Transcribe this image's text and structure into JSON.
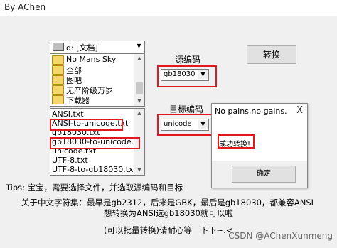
{
  "window": {
    "title": "By AChen"
  },
  "drive": {
    "label": "d: [文档]"
  },
  "folders": {
    "items": [
      "No Mans Sky",
      "全部",
      "图吧",
      "无产阶级万岁",
      "下载器"
    ]
  },
  "files": {
    "items": [
      "ANSI.txt",
      "ANSI-to-unicode.txt",
      "gb18030.txt",
      "gb18030-to-unicode.txt",
      "unicode.txt",
      "UTF-8.txt",
      "UTF-8-to-gb18030.txt"
    ]
  },
  "source": {
    "label": "源编码",
    "value": "gb18030"
  },
  "target": {
    "label": "目标编码",
    "value": "unicode"
  },
  "convert_button": {
    "label": "转换"
  },
  "dialog": {
    "title": "No pains,no gains.",
    "close": "X",
    "message": "成功转换!",
    "ok_label": "确定"
  },
  "tips": {
    "line": "Tips:  宝宝，需要选择文件，并选取源编码和目标",
    "charset_line1": "关于中文字符集：最早是gb2312，后来是GBK，最后是gb18030，都兼容ANSI",
    "charset_line2": "想转换为ANSI选gb18030就可以啦",
    "batch_line": "(可以批量转换)请耐心等一下下~.<"
  },
  "watermark": "CSDN @AChenXunmeng",
  "colors": {
    "highlight": "#e0191f",
    "folder": "#f5d66b"
  }
}
